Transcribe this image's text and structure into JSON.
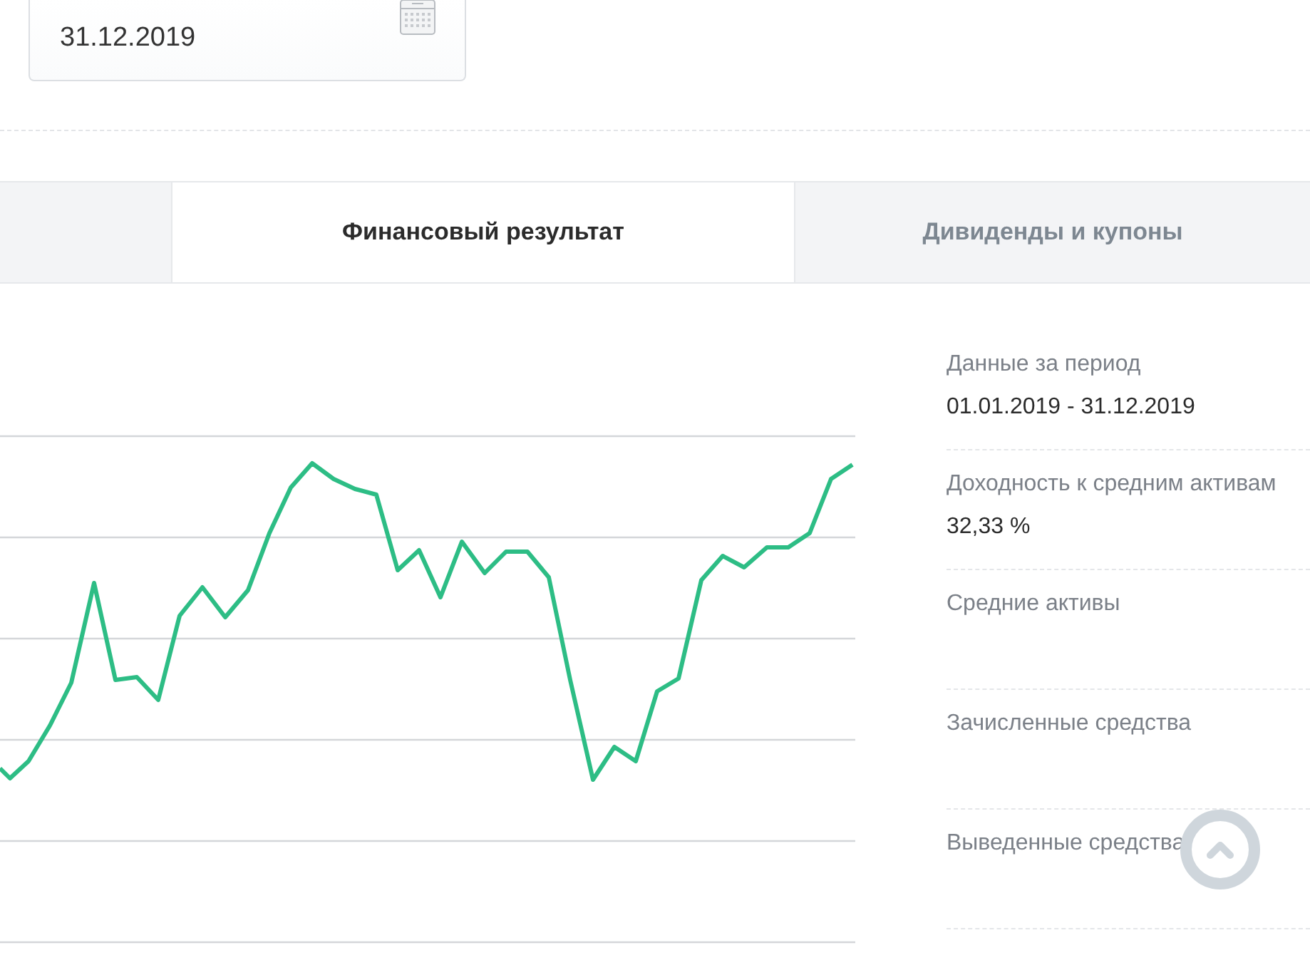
{
  "date_field": {
    "value": "31.12.2019"
  },
  "tabs": [
    {
      "selected": false
    },
    {
      "label": "Финансовый результат",
      "selected": true
    },
    {
      "label": "Дивиденды и купоны",
      "selected": false
    }
  ],
  "stats": [
    {
      "label": "Данные за период",
      "value": "01.01.2019 - 31.12.2019"
    },
    {
      "label": "Доходность к средним активам",
      "value": "32,33 %"
    },
    {
      "label": "Средние активы"
    },
    {
      "label": "Зачисленные средства"
    },
    {
      "label": "Выведенные средства"
    }
  ]
}
